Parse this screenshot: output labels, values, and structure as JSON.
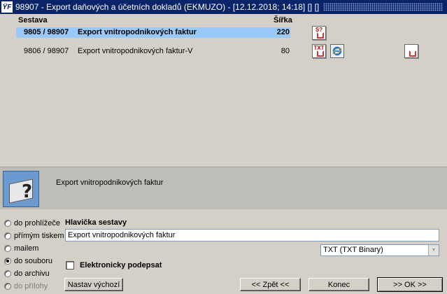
{
  "window": {
    "app_icon": "ŸF",
    "title": "98907 - Export daňových a účetních dokladů (EKMUZO) - [12.12.2018; 14:18] [] []"
  },
  "report_list": {
    "headers": {
      "sestava": "Sestava",
      "sirka": "Šířka"
    },
    "rows": [
      {
        "code": "9805 / 98907",
        "name": "Export vnitropodnikových faktur",
        "width": "220",
        "selected": true
      },
      {
        "code": "9806 / 98907",
        "name": "Export vnitropodnikových faktur-V",
        "width": "80",
        "selected": false
      }
    ],
    "icons": [
      "pdf-file-icon",
      "txt-file-icon",
      "internet-explorer-icon",
      "pdf-export-icon"
    ],
    "icon_text": {
      "pdf": "S?",
      "txt": "TXT"
    }
  },
  "info_panel": {
    "icon": "printer-help-icon",
    "text": "Export vnitropodnikových faktur"
  },
  "output_options": [
    {
      "label": "do prohlížeče",
      "checked": false,
      "enabled": true
    },
    {
      "label": "přímým tiskem",
      "checked": false,
      "enabled": true
    },
    {
      "label": "mailem",
      "checked": false,
      "enabled": true
    },
    {
      "label": "do souboru",
      "checked": true,
      "enabled": true
    },
    {
      "label": "do archivu",
      "checked": false,
      "enabled": true
    },
    {
      "label": "do přílohy",
      "checked": false,
      "enabled": false
    }
  ],
  "header_field": {
    "label": "Hlavička sestavy",
    "value": "Export vnitropodnikových faktur"
  },
  "format_select": {
    "value": "TXT (TXT Binary)"
  },
  "e_sign": {
    "label": "Elektronicky podepsat",
    "checked": false
  },
  "buttons": {
    "defaults": "Nastav výchozí",
    "back": "<< Zpět <<",
    "end": "Konec",
    "ok": ">> OK >>"
  },
  "colors": {
    "title_bar": "#0a246a",
    "selection": "#99c9f8",
    "info_bg": "#bfbdb8"
  }
}
